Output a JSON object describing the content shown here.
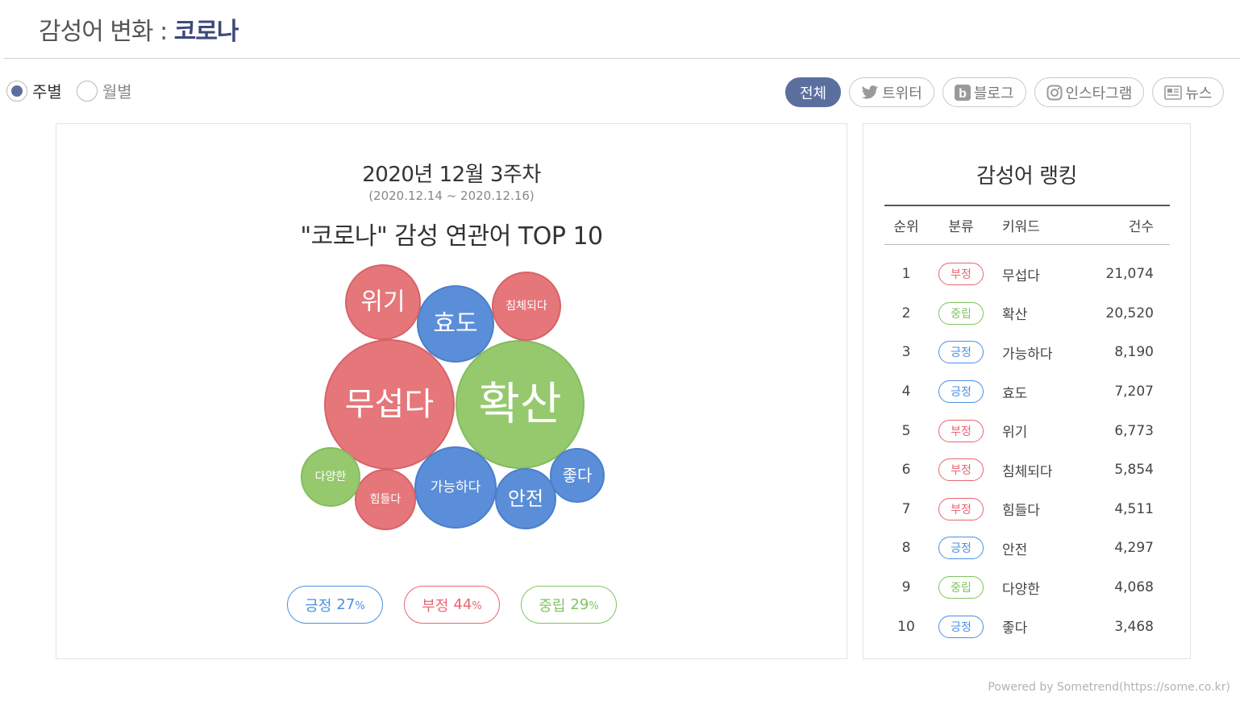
{
  "header": {
    "title": "감성어 변화 : ",
    "keyword": "코로나"
  },
  "period": {
    "weekly_label": "주별",
    "monthly_label": "월별",
    "selected": "weekly"
  },
  "channels": [
    {
      "label": "전체",
      "icon": "all",
      "active": true
    },
    {
      "label": "트위터",
      "icon": "twitter-icon",
      "active": false
    },
    {
      "label": "블로그",
      "icon": "blog-icon",
      "active": false
    },
    {
      "label": "인스타그램",
      "icon": "instagram-icon",
      "active": false
    },
    {
      "label": "뉴스",
      "icon": "news-icon",
      "active": false
    }
  ],
  "left": {
    "week_title": "2020년 12월 3주차",
    "week_range": "(2020.12.14 ~ 2020.12.16)",
    "chart_title": "\"코로나\" 감성 연관어 TOP 10"
  },
  "chart_data": {
    "type": "bubble",
    "colors": {
      "positive": "#5b8ed8",
      "negative": "#e5767a",
      "neutral": "#96c96e"
    },
    "bubbles": [
      {
        "label": "무섭다",
        "value": 21074,
        "sentiment": "negative"
      },
      {
        "label": "확산",
        "value": 20520,
        "sentiment": "neutral"
      },
      {
        "label": "가능하다",
        "value": 8190,
        "sentiment": "positive"
      },
      {
        "label": "효도",
        "value": 7207,
        "sentiment": "positive"
      },
      {
        "label": "위기",
        "value": 6773,
        "sentiment": "negative"
      },
      {
        "label": "침체되다",
        "value": 5854,
        "sentiment": "negative"
      },
      {
        "label": "힘들다",
        "value": 4511,
        "sentiment": "negative"
      },
      {
        "label": "안전",
        "value": 4297,
        "sentiment": "positive"
      },
      {
        "label": "다양한",
        "value": 4068,
        "sentiment": "neutral"
      },
      {
        "label": "좋다",
        "value": 3468,
        "sentiment": "positive"
      }
    ]
  },
  "legend": {
    "positive": {
      "label": "긍정",
      "pct": "27",
      "unit": "%"
    },
    "negative": {
      "label": "부정",
      "pct": "44",
      "unit": "%"
    },
    "neutral": {
      "label": "중립",
      "pct": "29",
      "unit": "%"
    }
  },
  "ranking": {
    "title": "감성어 랭킹",
    "headers": {
      "rank": "순위",
      "category": "분류",
      "keyword": "키워드",
      "count": "건수"
    },
    "rows": [
      {
        "rank": "1",
        "category": "부정",
        "type": "neg",
        "keyword": "무섭다",
        "count": "21,074"
      },
      {
        "rank": "2",
        "category": "중립",
        "type": "neu",
        "keyword": "확산",
        "count": "20,520"
      },
      {
        "rank": "3",
        "category": "긍정",
        "type": "pos",
        "keyword": "가능하다",
        "count": "8,190"
      },
      {
        "rank": "4",
        "category": "긍정",
        "type": "pos",
        "keyword": "효도",
        "count": "7,207"
      },
      {
        "rank": "5",
        "category": "부정",
        "type": "neg",
        "keyword": "위기",
        "count": "6,773"
      },
      {
        "rank": "6",
        "category": "부정",
        "type": "neg",
        "keyword": "침체되다",
        "count": "5,854"
      },
      {
        "rank": "7",
        "category": "부정",
        "type": "neg",
        "keyword": "힘들다",
        "count": "4,511"
      },
      {
        "rank": "8",
        "category": "긍정",
        "type": "pos",
        "keyword": "안전",
        "count": "4,297"
      },
      {
        "rank": "9",
        "category": "중립",
        "type": "neu",
        "keyword": "다양한",
        "count": "4,068"
      },
      {
        "rank": "10",
        "category": "긍정",
        "type": "pos",
        "keyword": "좋다",
        "count": "3,468"
      }
    ]
  },
  "footer": {
    "powered": "Powered by Sometrend(https://some.co.kr)"
  }
}
